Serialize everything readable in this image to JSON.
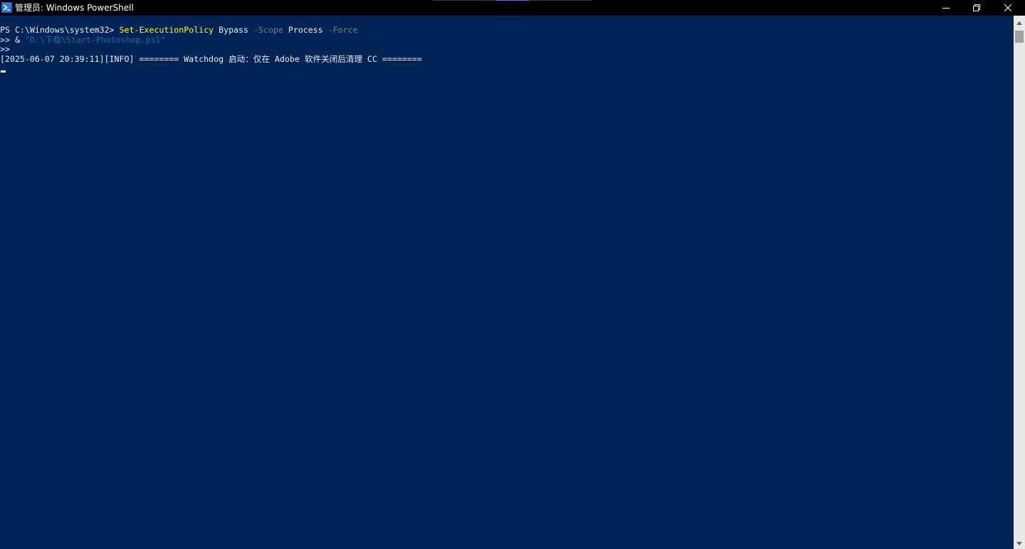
{
  "window": {
    "title": "管理员: Windows PowerShell",
    "app_icon": "powershell-icon",
    "controls": {
      "minimize_icon": "minimize-icon",
      "maximize_icon": "restore-icon",
      "close_icon": "close-icon"
    }
  },
  "console": {
    "background": "#012456",
    "foreground": "#eeedf0",
    "line1": {
      "prompt": "PS C:\\Windows\\system32> ",
      "command": "Set-ExecutionPolicy",
      "arg1": " Bypass ",
      "param1": "-Scope",
      "arg2": " Process ",
      "param2": "-Force"
    },
    "line2": {
      "prefix": ">> & ",
      "string": "\"D:\\下载\\Start-Photoshop.ps1\""
    },
    "line3": {
      "text": ">>"
    },
    "line4": {
      "text": "[2025-06-07 20:39:11][INFO] ======== Watchdog 启动：仅在 Adobe 软件关闭后清理 CC ========"
    },
    "colors": {
      "command": "#ffff00",
      "parameter": "#808080",
      "string": "#1a6d8f"
    }
  },
  "scrollbar": {
    "up_icon": "arrow-up-icon",
    "down_icon": "arrow-down-icon"
  }
}
